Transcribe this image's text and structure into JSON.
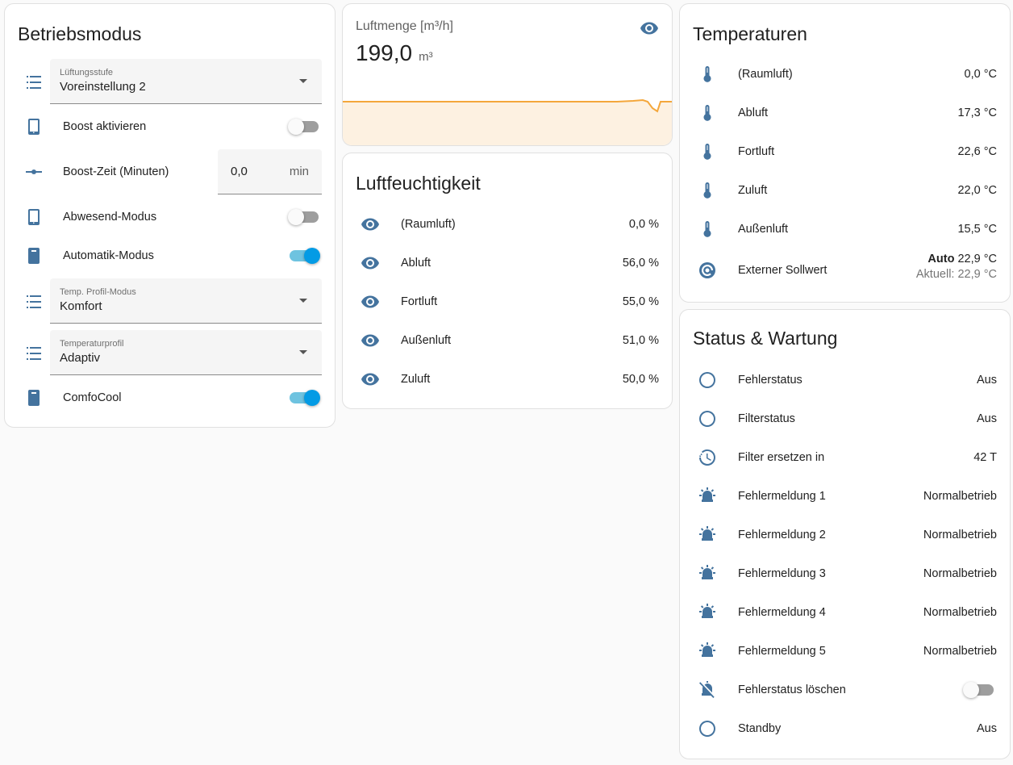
{
  "betriebsmodus": {
    "title": "Betriebsmodus",
    "lueftungsstufe": {
      "label": "Lüftungsstufe",
      "value": "Voreinstellung 2"
    },
    "boost": {
      "label": "Boost aktivieren",
      "on": false
    },
    "boost_zeit": {
      "label": "Boost-Zeit (Minuten)",
      "value": "0,0",
      "unit": "min"
    },
    "abwesend": {
      "label": "Abwesend-Modus",
      "on": false
    },
    "automatik": {
      "label": "Automatik-Modus",
      "on": true
    },
    "temp_profil_modus": {
      "label": "Temp. Profil-Modus",
      "value": "Komfort"
    },
    "temperaturprofil": {
      "label": "Temperaturprofil",
      "value": "Adaptiv"
    },
    "comfocool": {
      "label": "ComfoCool",
      "on": true
    }
  },
  "luftmenge": {
    "title": "Luftmenge [m³/h]",
    "value": "199,0",
    "unit": "m³",
    "accent": "#f4a73b",
    "fill": "#fdf1e1"
  },
  "luftfeuchtigkeit": {
    "title": "Luftfeuchtigkeit",
    "rows": [
      {
        "label": "(Raumluft)",
        "value": "0,0 %"
      },
      {
        "label": "Abluft",
        "value": "56,0 %"
      },
      {
        "label": "Fortluft",
        "value": "55,0 %"
      },
      {
        "label": "Außenluft",
        "value": "51,0 %"
      },
      {
        "label": "Zuluft",
        "value": "50,0 %"
      }
    ]
  },
  "temperaturen": {
    "title": "Temperaturen",
    "rows": [
      {
        "label": "(Raumluft)",
        "value": "0,0 °C"
      },
      {
        "label": "Abluft",
        "value": "17,3 °C"
      },
      {
        "label": "Fortluft",
        "value": "22,6 °C"
      },
      {
        "label": "Zuluft",
        "value": "22,0 °C"
      },
      {
        "label": "Außenluft",
        "value": "15,5 °C"
      }
    ],
    "sollwert": {
      "label": "Externer Sollwert",
      "mode": "Auto",
      "value": "22,9 °C",
      "current": "Aktuell: 22,9 °C"
    }
  },
  "status": {
    "title": "Status & Wartung",
    "rows": [
      {
        "label": "Fehlerstatus",
        "value": "Aus",
        "icon": "circle-outline-icon"
      },
      {
        "label": "Filterstatus",
        "value": "Aus",
        "icon": "circle-outline-icon"
      },
      {
        "label": "Filter ersetzen in",
        "value": "42 T",
        "icon": "timer-icon"
      },
      {
        "label": "Fehlermeldung 1",
        "value": "Normalbetrieb",
        "icon": "alarm-light-icon"
      },
      {
        "label": "Fehlermeldung 2",
        "value": "Normalbetrieb",
        "icon": "alarm-light-icon"
      },
      {
        "label": "Fehlermeldung 3",
        "value": "Normalbetrieb",
        "icon": "alarm-light-icon"
      },
      {
        "label": "Fehlermeldung 4",
        "value": "Normalbetrieb",
        "icon": "alarm-light-icon"
      },
      {
        "label": "Fehlermeldung 5",
        "value": "Normalbetrieb",
        "icon": "alarm-light-icon"
      }
    ],
    "loeschen": {
      "label": "Fehlerstatus löschen",
      "on": false,
      "icon": "alarm-light-off-icon"
    },
    "standby": {
      "label": "Standby",
      "value": "Aus",
      "icon": "circle-outline-icon"
    }
  },
  "colors": {
    "icon": "#44739e",
    "toggle_on": "#039be5"
  }
}
